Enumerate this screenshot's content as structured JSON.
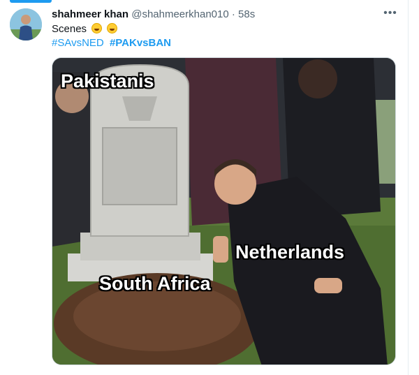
{
  "tweet": {
    "author_name": "shahmeer khan",
    "author_handle": "@shahmeerkhan010",
    "separator": "·",
    "time": "58s",
    "text": "Scenes",
    "emojis": [
      "face-with-tears-of-joy-icon",
      "face-with-tears-of-joy-icon"
    ],
    "hashtags": [
      "#SAvsNED",
      "#PAKvsBAN"
    ],
    "more_icon": "more-horizontal-icon"
  },
  "meme": {
    "labels": {
      "tombstone": "Pakistanis",
      "man": "Netherlands",
      "grave": "South Africa"
    }
  },
  "colors": {
    "link": "#1d9bf0",
    "text": "#0f1419",
    "secondary": "#536471",
    "accent": "#1d9bf0"
  }
}
